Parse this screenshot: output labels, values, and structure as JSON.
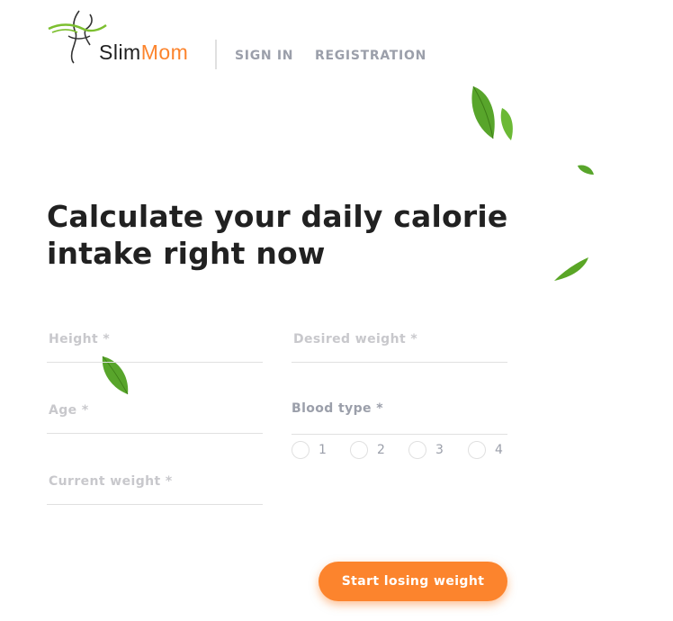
{
  "header": {
    "logo": {
      "part1": "Slim",
      "part2": "Mom"
    },
    "nav": {
      "sign_in": "SIGN IN",
      "registration": "REGISTRATION"
    }
  },
  "main": {
    "headline_line1": "Calculate your daily calorie",
    "headline_line2": "intake right now"
  },
  "form": {
    "height_label": "Height *",
    "desired_weight_label": "Desired weight *",
    "age_label": "Age *",
    "current_weight_label": "Current weight *",
    "blood_type": {
      "label": "Blood type *",
      "options": [
        "1",
        "2",
        "3",
        "4"
      ]
    },
    "submit_label": "Start losing weight"
  },
  "colors": {
    "accent": "#fc842d",
    "text_dark": "#212121",
    "text_muted": "#9b9faa",
    "line": "#e0e0e0",
    "leaf_green": "#5aa626"
  }
}
